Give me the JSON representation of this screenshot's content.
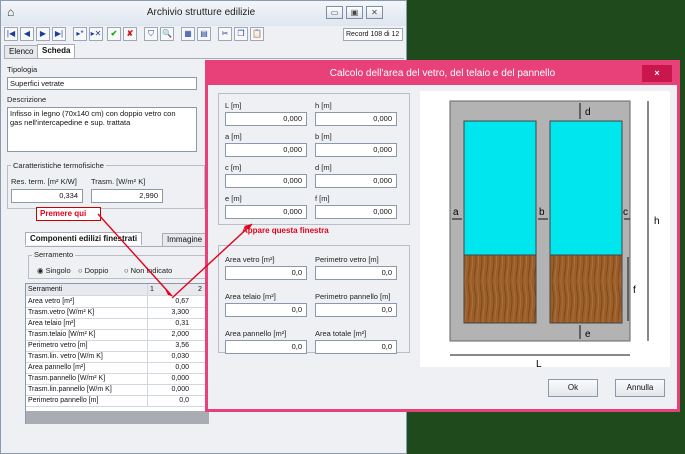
{
  "main_window": {
    "title": "Archivio strutture edilizie",
    "record": "Record 108 di 12",
    "tabs": [
      "Elenco",
      "Scheda"
    ],
    "tipologia_label": "Tipologia",
    "tipologia_value": "Superfici vetrate",
    "descrizione_label": "Descrizione",
    "descrizione_value": "Infisso in legno (70x140 cm) con doppio vetro con gas nell'intercapedine e sup. trattata",
    "thermo_group": "Caratteristiche termofisiche",
    "res_label": "Res. term. [m² K/W]",
    "res_value": "0,334",
    "trasm_label": "Trasm. [W/m² K]",
    "trasm_value": "2,990",
    "annotation_click": "Premere qui",
    "sub_tabs": [
      "Componenti edilizi finestrati",
      "Immagine"
    ],
    "serramento_group": "Serramento",
    "radio": [
      "Singolo",
      "Doppio",
      "Non indicato"
    ],
    "grid_header": [
      "Serramenti",
      "1",
      "2"
    ],
    "grid_rows": [
      {
        "label": "Area vetro [m²]",
        "value": "0,67"
      },
      {
        "label": "Trasm.vetro [W/m² K]",
        "value": "3,300"
      },
      {
        "label": "Area telaio [m²]",
        "value": "0,31"
      },
      {
        "label": "Trasm.telaio [W/m² K]",
        "value": "2,000"
      },
      {
        "label": "Perimetro vetro [m]",
        "value": "3,56"
      },
      {
        "label": "Trasm.lin. vetro [W/m K]",
        "value": "0,030"
      },
      {
        "label": "Area pannello [m²]",
        "value": "0,00"
      },
      {
        "label": "Trasm.pannello [W/m² K]",
        "value": "0,000"
      },
      {
        "label": "Trasm.lin.pannello [W/m K]",
        "value": "0,000"
      },
      {
        "label": "Perimetro pannello [m]",
        "value": "0,0"
      }
    ]
  },
  "dialog": {
    "title": "Calcolo dell'area del vetro, del telaio e del pannello",
    "close_glyph": "×",
    "fields": [
      {
        "label": "L [m]",
        "value": "0,000"
      },
      {
        "label": "h [m]",
        "value": "0,000"
      },
      {
        "label": "a [m]",
        "value": "0,000"
      },
      {
        "label": "b [m]",
        "value": "0,000"
      },
      {
        "label": "c [m]",
        "value": "0,000"
      },
      {
        "label": "d [m]",
        "value": "0,000"
      },
      {
        "label": "e [m]",
        "value": "0,000"
      },
      {
        "label": "f [m]",
        "value": "0,000"
      }
    ],
    "annotation_window": "Appare questa finestra",
    "results": [
      {
        "label": "Area vetro [m²]",
        "value": "0,0"
      },
      {
        "label": "Perimetro vetro [m]",
        "value": "0,0"
      },
      {
        "label": "Area telaio [m²]",
        "value": "0,0"
      },
      {
        "label": "Perimetro pannello [m]",
        "value": "0,0"
      },
      {
        "label": "Area pannello [m²]",
        "value": "0,0"
      },
      {
        "label": "Area totale [m²]",
        "value": "0,0"
      }
    ],
    "diagram_labels": {
      "d": "d",
      "h": "h",
      "a": "a",
      "b": "b",
      "c": "c",
      "f": "f",
      "e": "e",
      "L": "L"
    },
    "ok_label": "Ok",
    "cancel_label": "Annulla"
  },
  "colors": {
    "accent": "#e8417a",
    "glass": "#00e6ee",
    "wood": "#9a5e2a",
    "annotation": "#e3001b"
  }
}
